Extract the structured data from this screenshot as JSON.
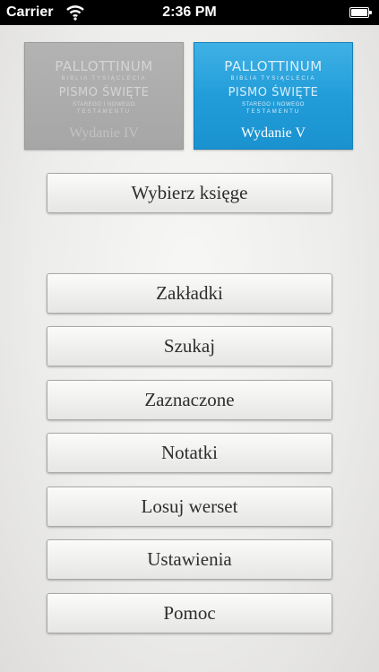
{
  "status_bar": {
    "carrier": "Carrier",
    "time": "2:36 PM",
    "wifi_icon": "wifi-icon",
    "battery_icon": "battery-icon"
  },
  "editions": [
    {
      "logo": "PALLOTTINUM",
      "logo_sub": "BIBLIA TYSIĄCLECIA",
      "title": "PISMO ŚWIĘTE",
      "subtitle_line1": "STAREGO I NOWEGO",
      "subtitle_line2": "TESTAMENTU",
      "label": "Wydanie IV",
      "selected": false,
      "color": "#a9a9a9"
    },
    {
      "logo": "PALLOTTINUM",
      "logo_sub": "BIBLIA TYSIĄCLECIA",
      "title": "PISMO ŚWIĘTE",
      "subtitle_line1": "STAREGO I NOWEGO",
      "subtitle_line2": "TESTAMENTU",
      "label": "Wydanie V",
      "selected": true,
      "color": "#1f9cd8"
    }
  ],
  "menu": {
    "choose_book": "Wybierz księge",
    "items": [
      "Zakładki",
      "Szukaj",
      "Zaznaczone",
      "Notatki",
      "Losuj werset",
      "Ustawienia",
      "Pomoc"
    ]
  }
}
